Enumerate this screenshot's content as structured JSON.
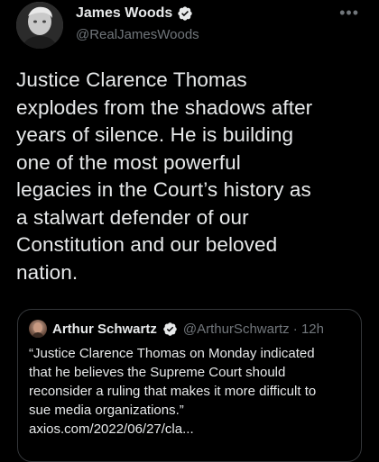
{
  "author": {
    "name": "James Woods",
    "handle": "@RealJamesWoods"
  },
  "more_label": "•••",
  "tweet": {
    "text": "Justice Clarence Thomas\nexplodes from the shadows after\nyears of silence. He is building\none of the most powerful\nlegacies in the Court’s history as\na stalwart defender of our\nConstitution and our beloved\nnation."
  },
  "quoted": {
    "name": "Arthur Schwartz",
    "handle_time": "@ArthurSchwartz · 12h",
    "text": "“Justice Clarence Thomas on Monday indicated\nthat he believes the Supreme Court should\nreconsider a ruling that makes it more difficult to\nsue media organizations.”\naxios.com/2022/06/27/cla..."
  },
  "colors": {
    "background": "#000000",
    "text": "#e7e9ea",
    "muted": "#71767b",
    "verified": "#1d9bf0",
    "border": "#333639"
  },
  "icons": {
    "verified": "verified-badge-icon",
    "more": "more-options-icon"
  }
}
